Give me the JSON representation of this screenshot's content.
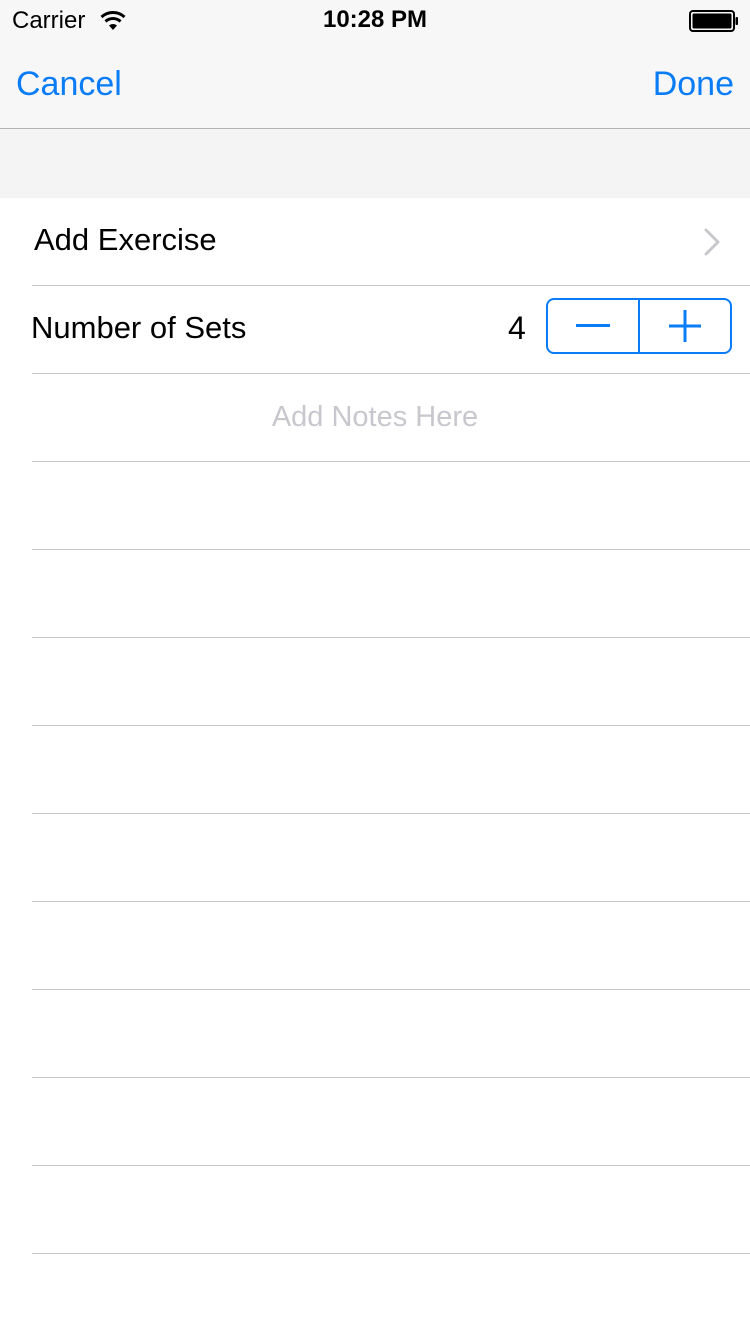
{
  "status_bar": {
    "carrier": "Carrier",
    "time": "10:28 PM",
    "wifi_icon": "wifi-icon",
    "battery_icon": "battery-icon"
  },
  "nav": {
    "cancel_label": "Cancel",
    "done_label": "Done",
    "tint_color": "#0a7cf5"
  },
  "rows": {
    "add_exercise": {
      "label": "Add Exercise",
      "accessory_icon": "chevron-right-icon"
    },
    "number_of_sets": {
      "label": "Number of Sets",
      "value": "4",
      "decrement_icon": "minus-icon",
      "increment_icon": "plus-icon"
    },
    "notes": {
      "placeholder": "Add Notes Here"
    }
  },
  "colors": {
    "separator": "#c8c7cc",
    "placeholder": "#c7c7cd",
    "background_gray": "#f4f4f4"
  }
}
